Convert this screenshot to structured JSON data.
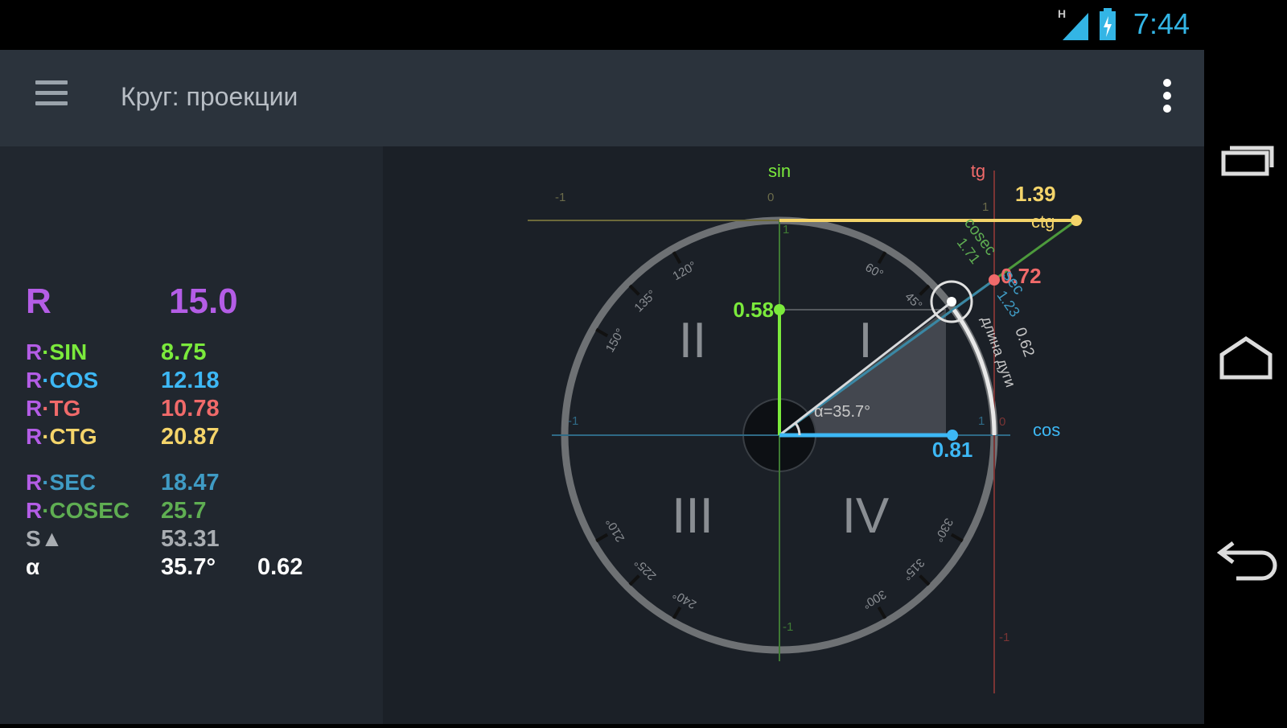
{
  "status": {
    "time": "7:44",
    "network": "H"
  },
  "app": {
    "title": "Круг: проекции"
  },
  "values": {
    "r_label": "R",
    "r_value": "15.0",
    "rows": [
      {
        "prefix": "R",
        "name": "·SIN",
        "value": "8.75",
        "color": "#7bea3c"
      },
      {
        "prefix": "R",
        "name": "·COS",
        "value": "12.18",
        "color": "#3db8f5"
      },
      {
        "prefix": "R",
        "name": "·TG",
        "value": "10.78",
        "color": "#f06a6a"
      },
      {
        "prefix": "R",
        "name": "·CTG",
        "value": "20.87",
        "color": "#f4d46a"
      },
      {
        "prefix": "R",
        "name": "·SEC",
        "value": "18.47",
        "color": "#3f9bc4"
      },
      {
        "prefix": "R",
        "name": "·COSEC",
        "value": "25.7",
        "color": "#5fae52"
      }
    ],
    "area_label": "S▲",
    "area_value": "53.31",
    "alpha_label": "α",
    "alpha_deg": "35.7°",
    "alpha_rad": "0.62"
  },
  "diagram": {
    "axis_sin": "sin",
    "axis_cos": "cos",
    "axis_tg": "tg",
    "axis_ctg": "ctg",
    "sin_value": "0.58",
    "cos_value": "0.81",
    "tg_value": "0.72",
    "ctg_value": "1.39",
    "cosec_label": "cosec",
    "cosec_value": "1.71",
    "sec_label": "sec",
    "sec_value": "1.23",
    "arc_label": "длина дуги",
    "arc_value": "0.62",
    "angle_label": "α=35.7°",
    "quadrants": [
      "I",
      "II",
      "III",
      "IV"
    ],
    "tick_neg1": "-1",
    "tick_0": "0",
    "tick_1": "1",
    "degree_marks": [
      "60°",
      "45°",
      "120°",
      "135°",
      "150°",
      "210°",
      "225°",
      "240°",
      "300°",
      "315°",
      "330°"
    ],
    "colors": {
      "sin": "#7bea3c",
      "cos": "#3db8f5",
      "tg": "#f06a6a",
      "ctg": "#f4d46a",
      "sec": "#3f9bc4",
      "cosec": "#5fae52"
    },
    "angle_deg": 35.7
  }
}
